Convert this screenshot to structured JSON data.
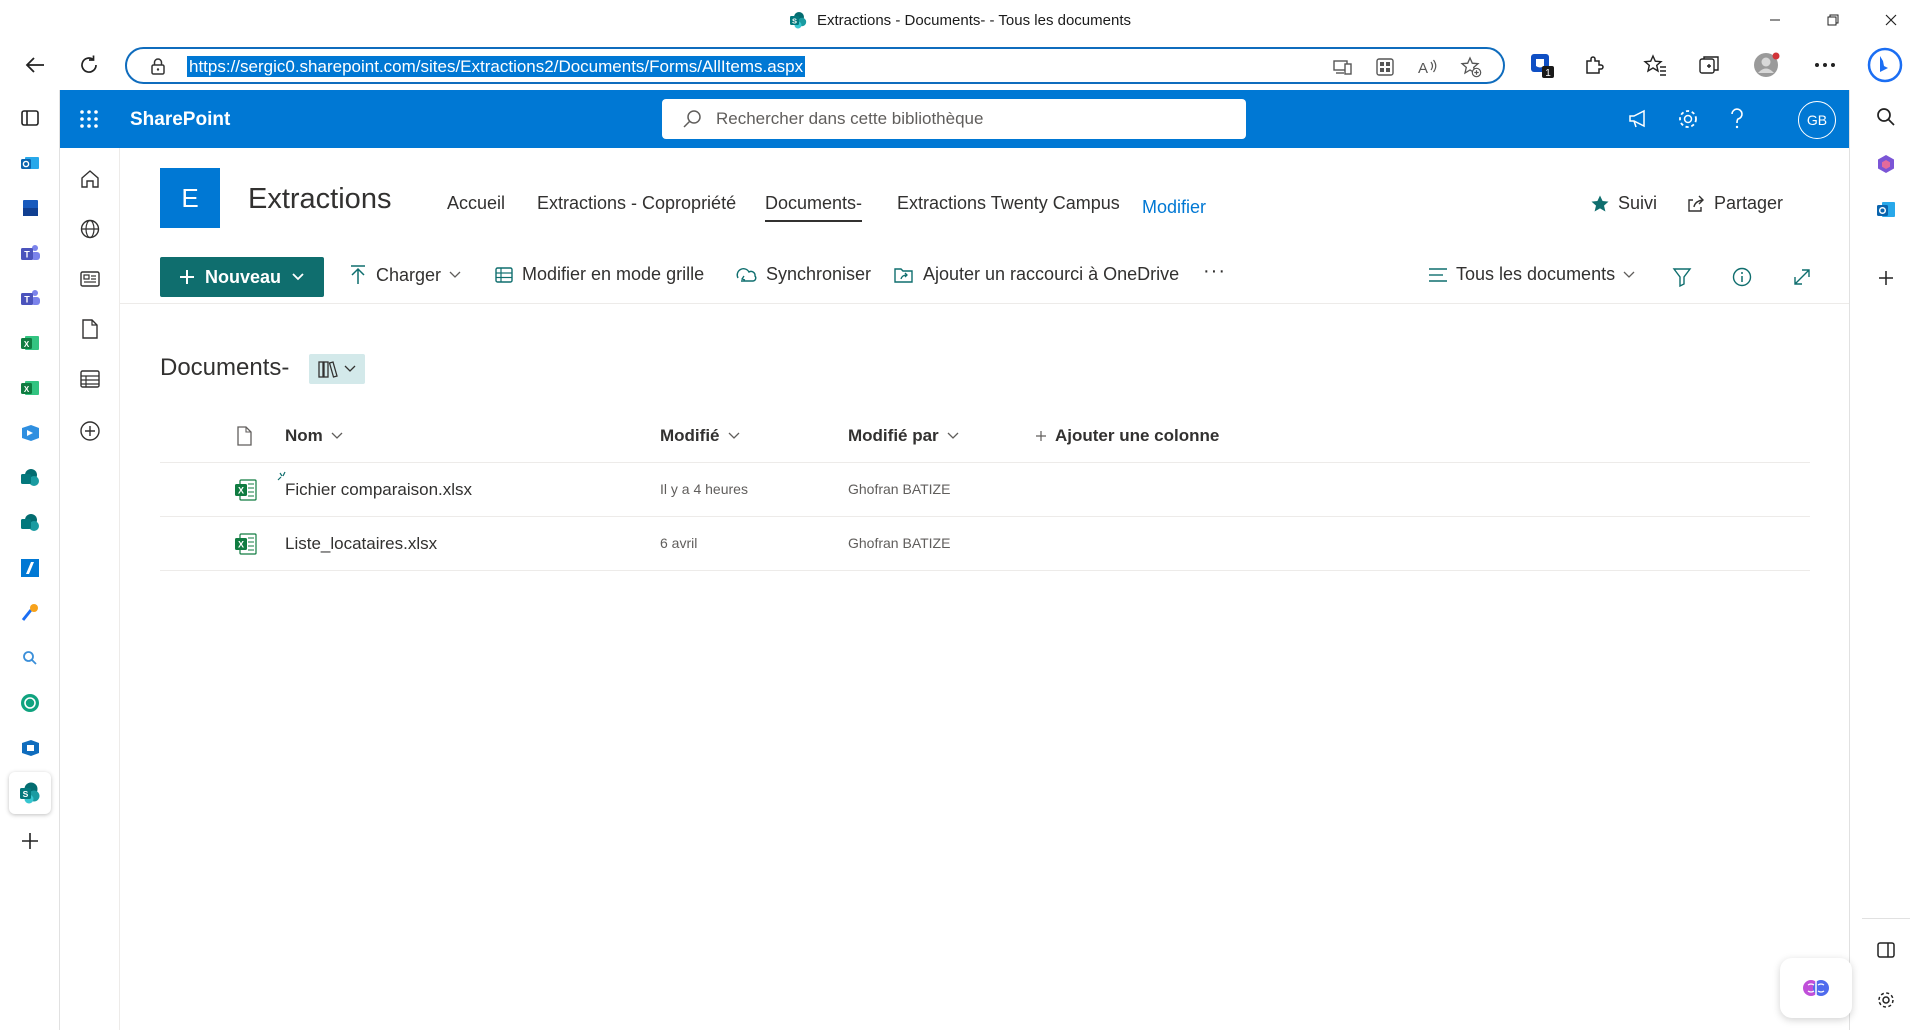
{
  "browser": {
    "tab_title": "Extractions - Documents- - Tous les documents",
    "url": "https://sergic0.sharepoint.com/sites/Extractions2/Documents/Forms/AllItems.aspx",
    "extension_badge": "1"
  },
  "suite": {
    "brand": "SharePoint",
    "search_placeholder": "Rechercher dans cette bibliothèque",
    "avatar_initials": "GB"
  },
  "site": {
    "logo_letter": "E",
    "title": "Extractions",
    "nav": [
      "Accueil",
      "Extractions - Copropriété",
      "Documents-",
      "Extractions Twenty Campus"
    ],
    "edit_label": "Modifier",
    "follow_label": "Suivi",
    "share_label": "Partager"
  },
  "commands": {
    "new_label": "Nouveau",
    "upload_label": "Charger",
    "grid_label": "Modifier en mode grille",
    "sync_label": "Synchroniser",
    "shortcut_label": "Ajouter un raccourci à OneDrive",
    "more_label": "···",
    "view_label": "Tous les documents"
  },
  "library": {
    "title": "Documents-",
    "columns": {
      "name": "Nom",
      "modified": "Modifié",
      "modified_by": "Modifié par",
      "add_column": "Ajouter une colonne"
    },
    "rows": [
      {
        "name": "Fichier comparaison.xlsx",
        "modified": "Il y a 4 heures",
        "modified_by": "Ghofran BATIZE"
      },
      {
        "name": "Liste_locataires.xlsx",
        "modified": "6 avril",
        "modified_by": "Ghofran BATIZE"
      }
    ]
  },
  "colors": {
    "suite_blue": "#0078d4",
    "new_button": "#0f6e6e",
    "excel_green": "#107c41"
  }
}
